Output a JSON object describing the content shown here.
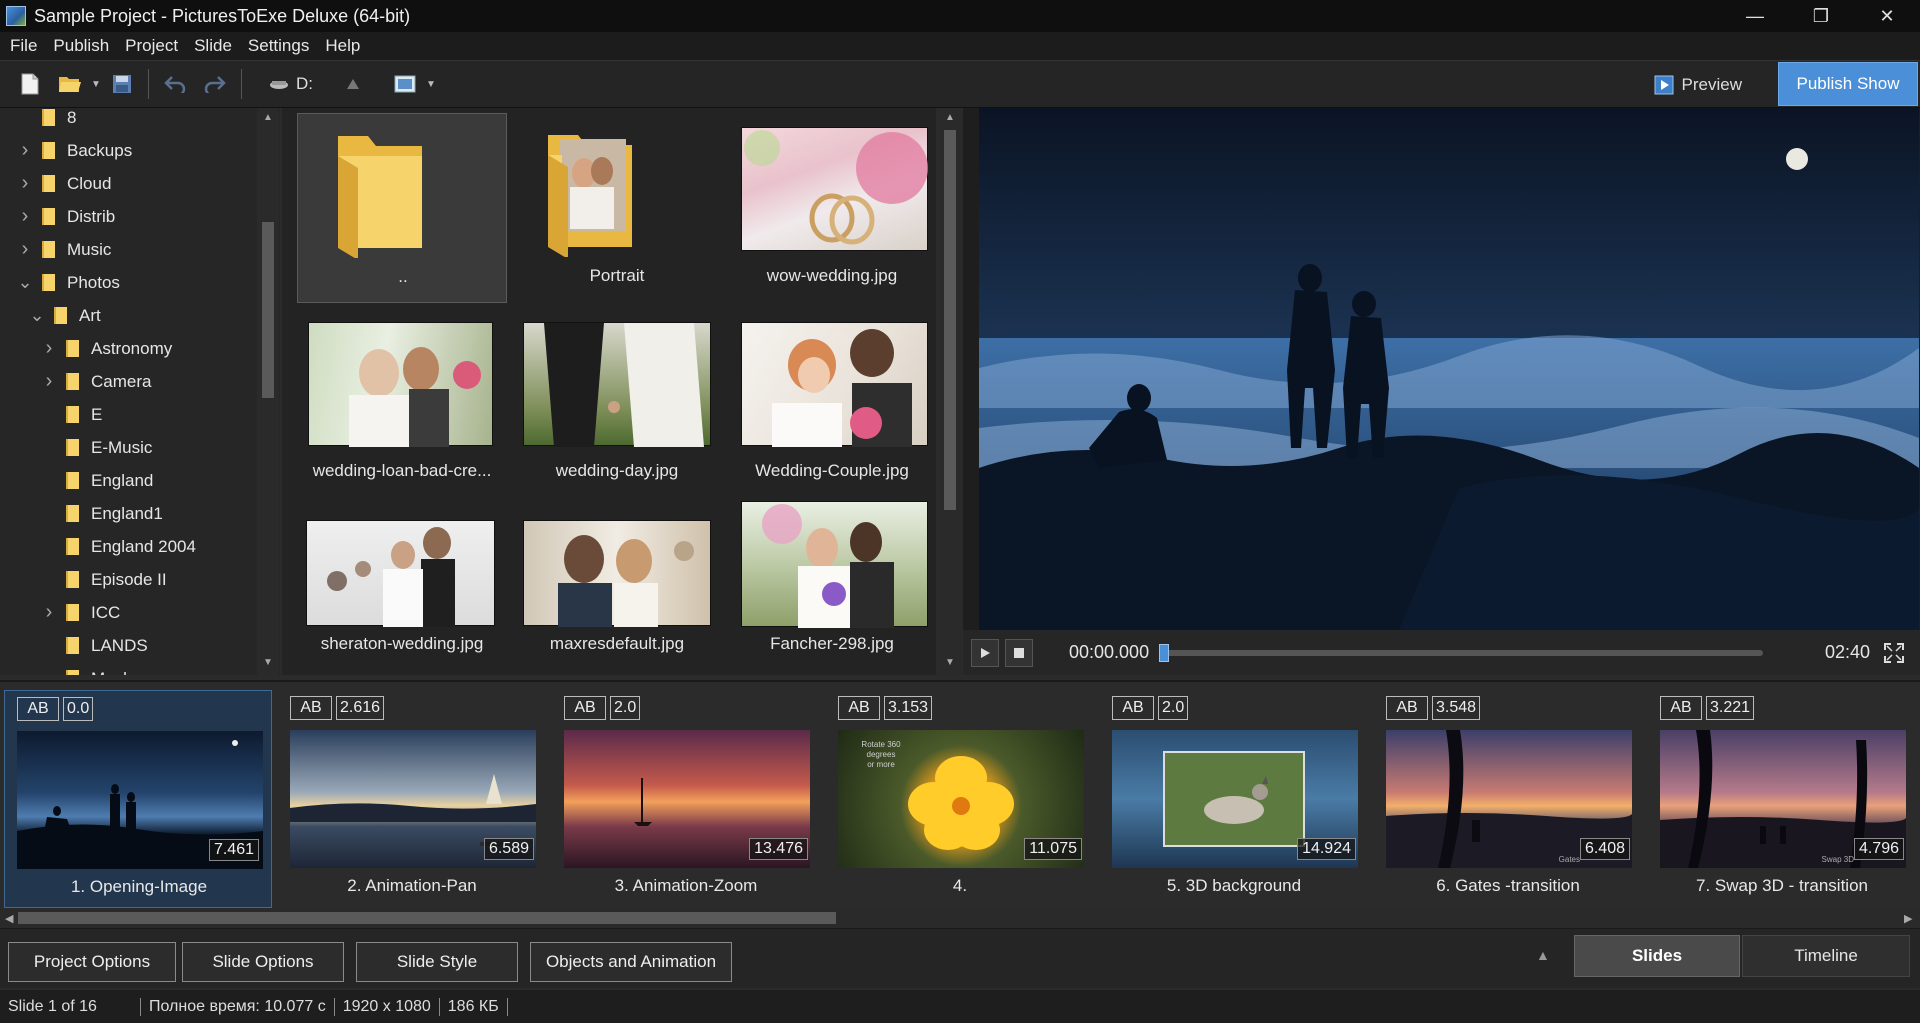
{
  "window": {
    "title": "Sample Project - PicturesToExe Deluxe (64-bit)",
    "minimize": "—",
    "maximize": "❐",
    "close": "✕"
  },
  "menu": [
    "File",
    "Publish",
    "Project",
    "Slide",
    "Settings",
    "Help"
  ],
  "toolbar": {
    "drive": "D:",
    "preview_label": "Preview",
    "publish_label": "Publish Show"
  },
  "tree": [
    {
      "label": "8",
      "indent": 0,
      "chevron": ""
    },
    {
      "label": "Backups",
      "indent": 0,
      "chevron": "right"
    },
    {
      "label": "Cloud",
      "indent": 0,
      "chevron": "right"
    },
    {
      "label": "Distrib",
      "indent": 0,
      "chevron": "right"
    },
    {
      "label": "Music",
      "indent": 0,
      "chevron": "right"
    },
    {
      "label": "Photos",
      "indent": 0,
      "chevron": "down"
    },
    {
      "label": "Art",
      "indent": 1,
      "chevron": "down"
    },
    {
      "label": "Astronomy",
      "indent": 2,
      "chevron": "right"
    },
    {
      "label": "Camera",
      "indent": 2,
      "chevron": "right"
    },
    {
      "label": "E",
      "indent": 2,
      "chevron": ""
    },
    {
      "label": "E-Music",
      "indent": 2,
      "chevron": ""
    },
    {
      "label": "England",
      "indent": 2,
      "chevron": ""
    },
    {
      "label": "England1",
      "indent": 2,
      "chevron": ""
    },
    {
      "label": "England 2004",
      "indent": 2,
      "chevron": ""
    },
    {
      "label": "Episode II",
      "indent": 2,
      "chevron": ""
    },
    {
      "label": "ICC",
      "indent": 2,
      "chevron": "right"
    },
    {
      "label": "LANDS",
      "indent": 2,
      "chevron": ""
    },
    {
      "label": "Mask",
      "indent": 2,
      "chevron": ""
    }
  ],
  "files": [
    {
      "name": "..",
      "kind": "parent-folder"
    },
    {
      "name": "Portrait",
      "kind": "folder"
    },
    {
      "name": "wow-wedding.jpg",
      "kind": "image"
    },
    {
      "name": "wedding-loan-bad-cre...",
      "kind": "image"
    },
    {
      "name": "wedding-day.jpg",
      "kind": "image"
    },
    {
      "name": "Wedding-Couple.jpg",
      "kind": "image"
    },
    {
      "name": "sheraton-wedding.jpg",
      "kind": "image"
    },
    {
      "name": "maxresdefault.jpg",
      "kind": "image"
    },
    {
      "name": "Fancher-298.jpg",
      "kind": "image"
    }
  ],
  "player": {
    "current": "00:00.000",
    "total": "02:40",
    "progress": 0
  },
  "slides": [
    {
      "ab": "AB",
      "pause": "0.0",
      "time": "7.461",
      "name": "1. Opening-Image"
    },
    {
      "ab": "AB",
      "pause": "2.616",
      "time": "6.589",
      "name": "2. Animation-Pan"
    },
    {
      "ab": "AB",
      "pause": "2.0",
      "time": "13.476",
      "name": "3. Animation-Zoom"
    },
    {
      "ab": "AB",
      "pause": "3.153",
      "time": "11.075",
      "name": "4."
    },
    {
      "ab": "AB",
      "pause": "2.0",
      "time": "14.924",
      "name": "5. 3D background"
    },
    {
      "ab": "AB",
      "pause": "3.548",
      "time": "6.408",
      "name": "6. Gates -transition"
    },
    {
      "ab": "AB",
      "pause": "3.221",
      "time": "4.796",
      "name": "7. Swap 3D - transition"
    }
  ],
  "slide4_overlay": "Rotate 360 degrees\nor more",
  "slide6_overlay": "Gates",
  "slide7_overlay": "Swap 3D",
  "bottom": {
    "project_options": "Project Options",
    "slide_options": "Slide Options",
    "slide_style": "Slide Style",
    "objects_animation": "Objects and Animation",
    "tab_slides": "Slides",
    "tab_timeline": "Timeline"
  },
  "status": {
    "slide": "Slide 1 of 16",
    "total_time": "Полное время: 10.077 с",
    "resolution": "1920 x 1080",
    "size": "186 КБ"
  },
  "colors": {
    "accent": "#4a8fd8",
    "folder": "#f6d36b",
    "selected_slide": "#22364d"
  }
}
